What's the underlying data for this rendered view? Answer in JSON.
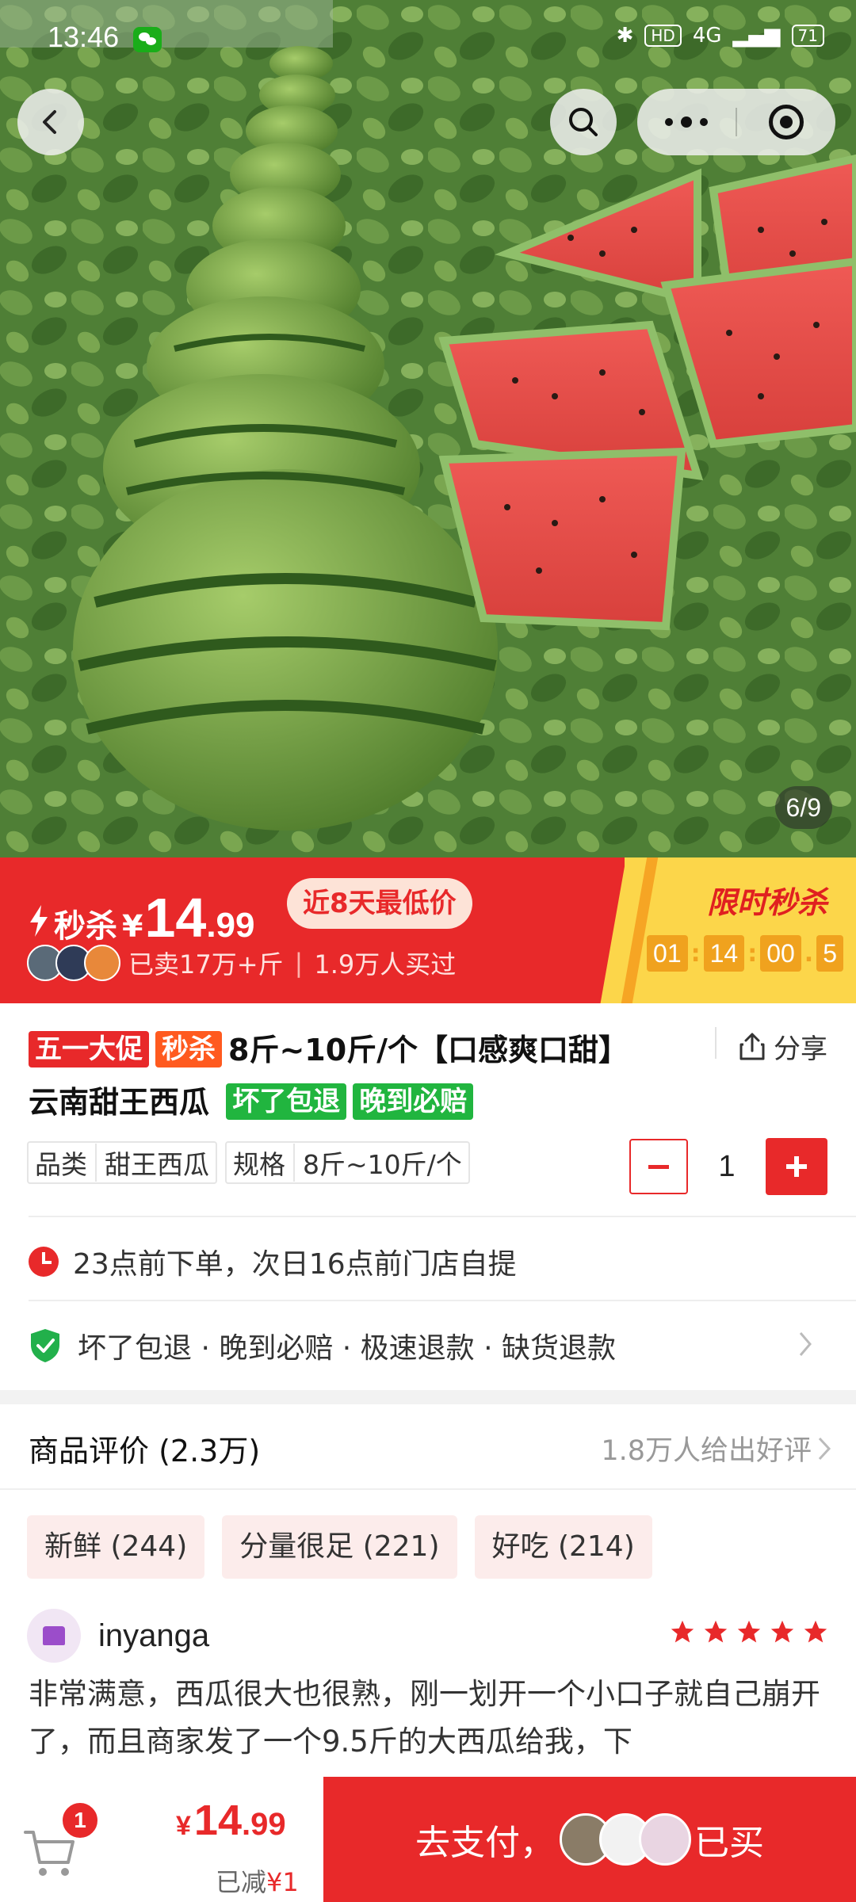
{
  "status_bar": {
    "time": "13:46",
    "network": "4G",
    "battery": "71"
  },
  "image": {
    "counter": "6/9"
  },
  "flash_sale": {
    "label": "秒杀",
    "currency": "¥",
    "price_int": "14",
    "price_dec": ".99",
    "lowest_tag": "近8天最低价",
    "sold": "已卖17万+斤",
    "bought": "1.9万人买过",
    "sale_title": "限时秒杀",
    "countdown": [
      "01",
      "14",
      "00",
      "5"
    ]
  },
  "product": {
    "tag_promo": "五一大促",
    "tag_flash": "秒杀",
    "title_line1": "8斤~10斤/个【口感爽口甜】",
    "title_line2": "云南甜王西瓜",
    "tag_refund": "坏了包退",
    "tag_late": "晚到必赔",
    "share_label": "分享",
    "specs": [
      {
        "key": "品类",
        "value": "甜王西瓜"
      },
      {
        "key": "规格",
        "value": "8斤~10斤/个"
      }
    ],
    "quantity": "1",
    "pickup": "23点前下单，次日16点前门店自提",
    "guarantees": "坏了包退 · 晚到必赔 · 极速退款 · 缺货退款"
  },
  "reviews": {
    "header": "商品评价 (2.3万)",
    "good_count": "1.8万人给出好评",
    "tags": [
      "新鲜 (244)",
      "分量很足 (221)",
      "好吃 (214)"
    ],
    "user": "inyanga",
    "stars": 5,
    "text": "非常满意，西瓜很大也很熟，刚一划开一个小口子就自己崩开了，而且商家发了一个9.5斤的大西瓜给我，下"
  },
  "bottom_bar": {
    "cart_count": "1",
    "currency": "¥",
    "price_int": "14",
    "price_dec": ".99",
    "discount_label": "已减",
    "discount_value": "¥1",
    "pay_label": "去支付，",
    "bought_label": "已买"
  },
  "colors": {
    "accent": "#e8292a",
    "flash_yellow": "#fcd64a",
    "green_tag": "#21b53f"
  }
}
